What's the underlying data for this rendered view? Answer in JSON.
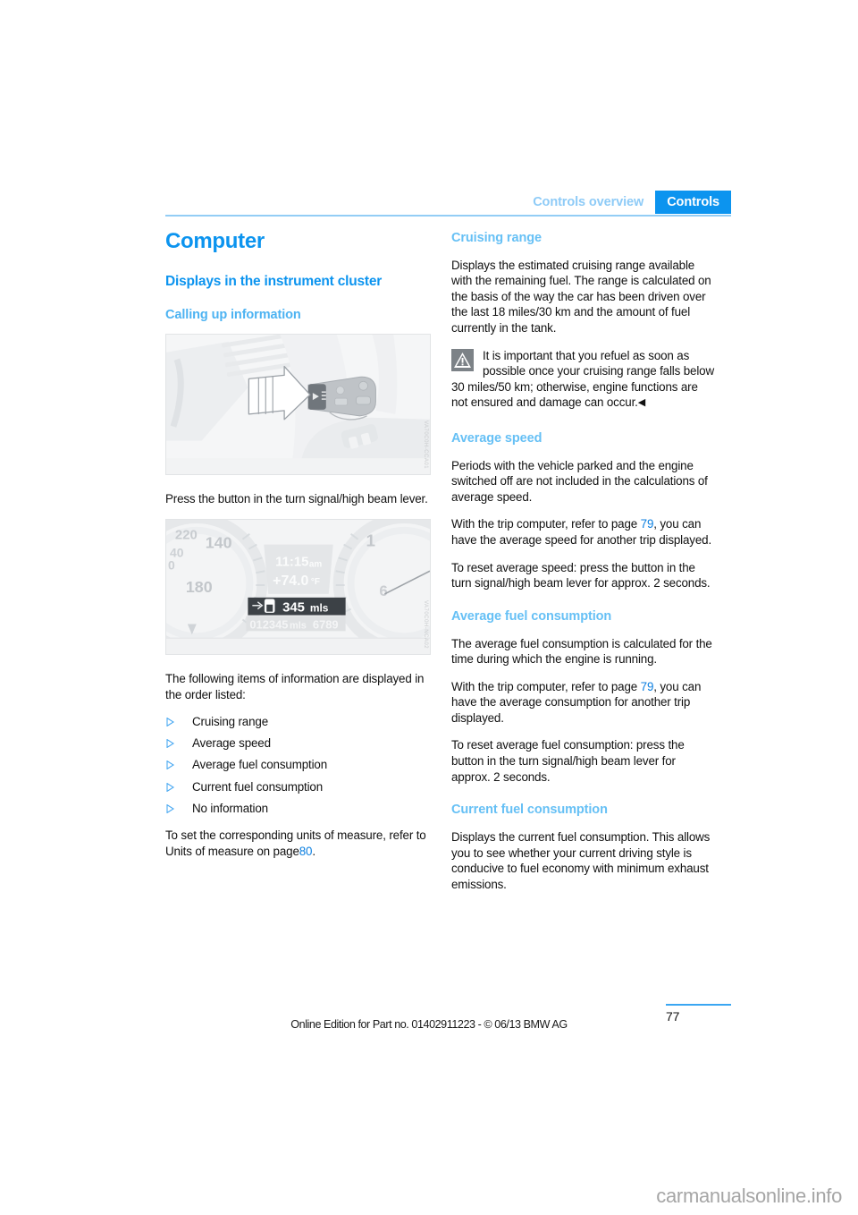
{
  "header": {
    "tab_inactive": "Controls overview",
    "tab_active": "Controls",
    "accent_color": "#0c94ef",
    "rule_color": "#93cdf5"
  },
  "left_column": {
    "title": "Computer",
    "section_heading": "Displays in the instrument cluster",
    "sub_heading": "Calling up information",
    "figure_lever": {
      "name": "turn-signal-high-beam-lever-illustration",
      "code": "VA70C0H-CCA01"
    },
    "caption_1": "Press the button in the turn signal/high beam lever.",
    "figure_cluster": {
      "name": "instrument-cluster-display-illustration",
      "code": "VA70C0H-NCA02",
      "speedo_labels": [
        "220",
        "140",
        "0",
        "180",
        "40"
      ],
      "tach_label": "1",
      "time": "11:15am",
      "temperature": "+74.0 °F",
      "range_value": "345mls",
      "odometer": "012345mls",
      "trip": "6789"
    },
    "list_intro": "The following items of information are displayed in the order listed:",
    "list_items": [
      "Cruising range",
      "Average speed",
      "Average fuel consumption",
      "Current fuel consumption",
      "No information"
    ],
    "closing_text_a": "To set the corresponding units of measure, refer to Units of measure on page",
    "closing_page_ref": "80",
    "closing_text_b": "."
  },
  "right_column": {
    "sections": [
      {
        "heading": "Cruising range",
        "paragraph": "Displays the estimated cruising range available with the remaining fuel. The range is calculated on the basis of the way the car has been driven over the last 18 miles/30 km and the amount of fuel currently in the tank.",
        "note": "It is important that you refuel as soon as possible once your cruising range falls below 30 miles/50 km; otherwise, engine functions are not ensured and damage can occur.",
        "note_endmark": "◀",
        "note_icon": "warning-triangle-icon"
      },
      {
        "heading": "Average speed",
        "paragraph_1": "Periods with the vehicle parked and the engine switched off are not included in the calculations of average speed.",
        "paragraph_2_a": "With the trip computer, refer to page",
        "paragraph_2_ref": "79",
        "paragraph_2_b": ", you can have the average speed for another trip displayed.",
        "paragraph_3": "To reset average speed: press the button in the turn signal/high beam lever for approx. 2 seconds."
      },
      {
        "heading": "Average fuel consumption",
        "paragraph_1": "The average fuel consumption is calculated for the time during which the engine is running.",
        "paragraph_2_a": "With the trip computer, refer to page",
        "paragraph_2_ref": "79",
        "paragraph_2_b": ", you can have the average consumption for another trip displayed.",
        "paragraph_3": "To reset average fuel consumption: press the button in the turn signal/high beam lever for approx. 2 seconds."
      },
      {
        "heading": "Current fuel consumption",
        "paragraph_1": "Displays the current fuel consumption. This allows you to see whether your current driving style is conducive to fuel economy with minimum exhaust emissions."
      }
    ]
  },
  "footer": {
    "page_number": "77",
    "edition": "Online Edition for Part no. 01402911223 - © 06/13 BMW AG",
    "watermark": "carmanualsonline.info"
  }
}
